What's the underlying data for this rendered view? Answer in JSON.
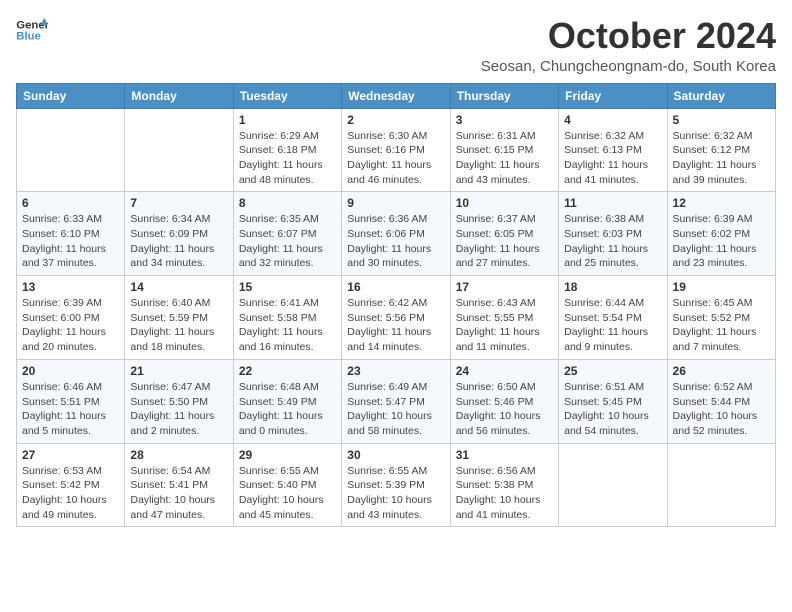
{
  "logo": {
    "line1": "General",
    "line2": "Blue"
  },
  "title": "October 2024",
  "location": "Seosan, Chungcheongnam-do, South Korea",
  "days_of_week": [
    "Sunday",
    "Monday",
    "Tuesday",
    "Wednesday",
    "Thursday",
    "Friday",
    "Saturday"
  ],
  "weeks": [
    [
      {
        "day": "",
        "info": ""
      },
      {
        "day": "",
        "info": ""
      },
      {
        "day": "1",
        "info": "Sunrise: 6:29 AM\nSunset: 6:18 PM\nDaylight: 11 hours and 48 minutes."
      },
      {
        "day": "2",
        "info": "Sunrise: 6:30 AM\nSunset: 6:16 PM\nDaylight: 11 hours and 46 minutes."
      },
      {
        "day": "3",
        "info": "Sunrise: 6:31 AM\nSunset: 6:15 PM\nDaylight: 11 hours and 43 minutes."
      },
      {
        "day": "4",
        "info": "Sunrise: 6:32 AM\nSunset: 6:13 PM\nDaylight: 11 hours and 41 minutes."
      },
      {
        "day": "5",
        "info": "Sunrise: 6:32 AM\nSunset: 6:12 PM\nDaylight: 11 hours and 39 minutes."
      }
    ],
    [
      {
        "day": "6",
        "info": "Sunrise: 6:33 AM\nSunset: 6:10 PM\nDaylight: 11 hours and 37 minutes."
      },
      {
        "day": "7",
        "info": "Sunrise: 6:34 AM\nSunset: 6:09 PM\nDaylight: 11 hours and 34 minutes."
      },
      {
        "day": "8",
        "info": "Sunrise: 6:35 AM\nSunset: 6:07 PM\nDaylight: 11 hours and 32 minutes."
      },
      {
        "day": "9",
        "info": "Sunrise: 6:36 AM\nSunset: 6:06 PM\nDaylight: 11 hours and 30 minutes."
      },
      {
        "day": "10",
        "info": "Sunrise: 6:37 AM\nSunset: 6:05 PM\nDaylight: 11 hours and 27 minutes."
      },
      {
        "day": "11",
        "info": "Sunrise: 6:38 AM\nSunset: 6:03 PM\nDaylight: 11 hours and 25 minutes."
      },
      {
        "day": "12",
        "info": "Sunrise: 6:39 AM\nSunset: 6:02 PM\nDaylight: 11 hours and 23 minutes."
      }
    ],
    [
      {
        "day": "13",
        "info": "Sunrise: 6:39 AM\nSunset: 6:00 PM\nDaylight: 11 hours and 20 minutes."
      },
      {
        "day": "14",
        "info": "Sunrise: 6:40 AM\nSunset: 5:59 PM\nDaylight: 11 hours and 18 minutes."
      },
      {
        "day": "15",
        "info": "Sunrise: 6:41 AM\nSunset: 5:58 PM\nDaylight: 11 hours and 16 minutes."
      },
      {
        "day": "16",
        "info": "Sunrise: 6:42 AM\nSunset: 5:56 PM\nDaylight: 11 hours and 14 minutes."
      },
      {
        "day": "17",
        "info": "Sunrise: 6:43 AM\nSunset: 5:55 PM\nDaylight: 11 hours and 11 minutes."
      },
      {
        "day": "18",
        "info": "Sunrise: 6:44 AM\nSunset: 5:54 PM\nDaylight: 11 hours and 9 minutes."
      },
      {
        "day": "19",
        "info": "Sunrise: 6:45 AM\nSunset: 5:52 PM\nDaylight: 11 hours and 7 minutes."
      }
    ],
    [
      {
        "day": "20",
        "info": "Sunrise: 6:46 AM\nSunset: 5:51 PM\nDaylight: 11 hours and 5 minutes."
      },
      {
        "day": "21",
        "info": "Sunrise: 6:47 AM\nSunset: 5:50 PM\nDaylight: 11 hours and 2 minutes."
      },
      {
        "day": "22",
        "info": "Sunrise: 6:48 AM\nSunset: 5:49 PM\nDaylight: 11 hours and 0 minutes."
      },
      {
        "day": "23",
        "info": "Sunrise: 6:49 AM\nSunset: 5:47 PM\nDaylight: 10 hours and 58 minutes."
      },
      {
        "day": "24",
        "info": "Sunrise: 6:50 AM\nSunset: 5:46 PM\nDaylight: 10 hours and 56 minutes."
      },
      {
        "day": "25",
        "info": "Sunrise: 6:51 AM\nSunset: 5:45 PM\nDaylight: 10 hours and 54 minutes."
      },
      {
        "day": "26",
        "info": "Sunrise: 6:52 AM\nSunset: 5:44 PM\nDaylight: 10 hours and 52 minutes."
      }
    ],
    [
      {
        "day": "27",
        "info": "Sunrise: 6:53 AM\nSunset: 5:42 PM\nDaylight: 10 hours and 49 minutes."
      },
      {
        "day": "28",
        "info": "Sunrise: 6:54 AM\nSunset: 5:41 PM\nDaylight: 10 hours and 47 minutes."
      },
      {
        "day": "29",
        "info": "Sunrise: 6:55 AM\nSunset: 5:40 PM\nDaylight: 10 hours and 45 minutes."
      },
      {
        "day": "30",
        "info": "Sunrise: 6:55 AM\nSunset: 5:39 PM\nDaylight: 10 hours and 43 minutes."
      },
      {
        "day": "31",
        "info": "Sunrise: 6:56 AM\nSunset: 5:38 PM\nDaylight: 10 hours and 41 minutes."
      },
      {
        "day": "",
        "info": ""
      },
      {
        "day": "",
        "info": ""
      }
    ]
  ]
}
